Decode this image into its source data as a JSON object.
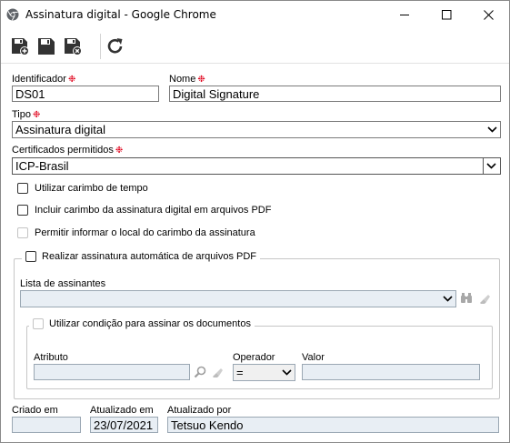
{
  "window": {
    "title": "Assinatura digital - Google Chrome",
    "minimize_label": "minimize",
    "maximize_label": "maximize",
    "close_label": "close"
  },
  "toolbar": {
    "icons": [
      "save-new-icon",
      "save-icon",
      "save-close-icon",
      "refresh-icon"
    ]
  },
  "form": {
    "identificador_label": "Identificador",
    "identificador_value": "DS01",
    "nome_label": "Nome",
    "nome_value": "Digital Signature",
    "tipo_label": "Tipo",
    "tipo_value": "Assinatura digital",
    "certificados_label": "Certificados permitidos",
    "certificados_value": "ICP-Brasil",
    "required_mark": "❉",
    "checkboxes": [
      {
        "label": "Utilizar carimbo de tempo",
        "checked": false,
        "enabled": true
      },
      {
        "label": "Incluir carimbo da assinatura digital em arquivos PDF",
        "checked": false,
        "enabled": true
      },
      {
        "label": "Permitir informar o local do carimbo da assinatura",
        "checked": false,
        "enabled": false
      }
    ],
    "auto_sign": {
      "label": "Realizar assinatura automática de arquivos PDF",
      "checked": false,
      "lista_label": "Lista de assinantes",
      "lista_value": "",
      "condition": {
        "label": "Utilizar condição para assinar os documentos",
        "checked": false,
        "atributo_label": "Atributo",
        "atributo_value": "",
        "operador_label": "Operador",
        "operador_value": "=",
        "valor_label": "Valor",
        "valor_value": ""
      }
    },
    "criado_label": "Criado em",
    "criado_value": "",
    "atualizado_em_label": "Atualizado em",
    "atualizado_em_value": "23/07/2021",
    "atualizado_por_label": "Atualizado por",
    "atualizado_por_value": "Tetsuo Kendo"
  }
}
